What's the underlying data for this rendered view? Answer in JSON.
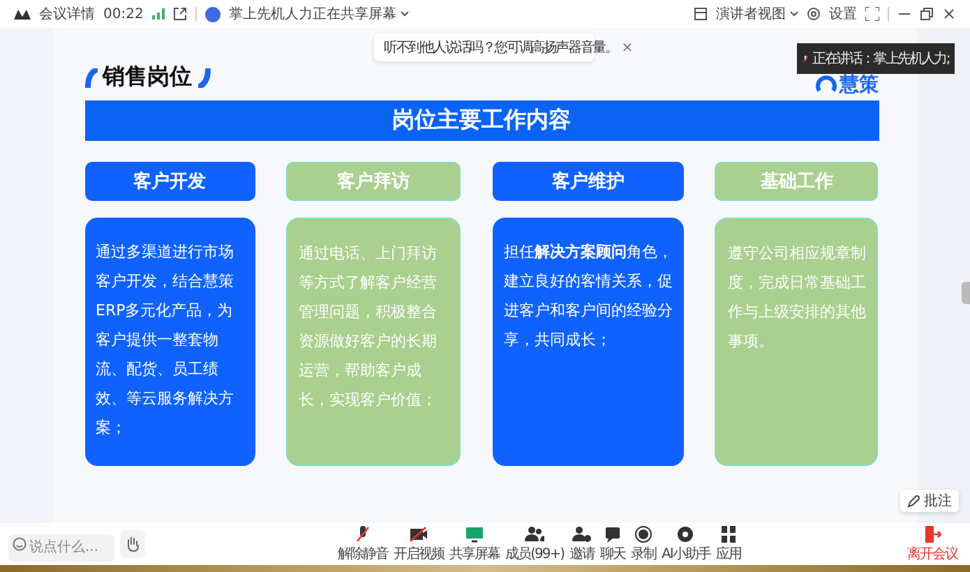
{
  "top_bar": {
    "app_label": "会议详情",
    "timer": "00:22",
    "share_status": "掌上先机人力正在共享屏幕",
    "view_menu": "演讲者视图",
    "settings": "设置"
  },
  "toast": {
    "message": "听不到他人说话吗？您可调高扬声器音量。",
    "close": "×"
  },
  "speaker_overlay": {
    "text": "正在讲话：掌上先机人力;"
  },
  "slide": {
    "heading": "销售岗位",
    "logo_text": "慧策",
    "banner": "岗位主要工作内容",
    "columns": [
      {
        "title": "客户开发",
        "color": "#0f62fe",
        "body": "通过多渠道进行市场客户开发，结合慧策ERP多元化产品，为客户提供一整套物流、配货、员工绩效、等云服务解决方案；"
      },
      {
        "title": "客户拜访",
        "color": "#a9d08e",
        "body": "通过电话、上门拜访等方式了解客户经营管理问题，积极整合资源做好客户的长期运营，帮助客户成长，实现客户价值；"
      },
      {
        "title": "客户维护",
        "color": "#0f62fe",
        "body": "担任**解决方案顾问**角色，建立良好的客情关系，促进客户和客户间的经验分享，共同成长；"
      },
      {
        "title": "基础工作",
        "color": "#a9d08e",
        "body": "遵守公司相应规章制度，完成日常基础工作与上级安排的其他事项。"
      }
    ]
  },
  "annotate_button": "批注",
  "bottom_bar": {
    "chat": {
      "placeholder": "说点什么..."
    },
    "tools": [
      {
        "label": "解除静音",
        "kind": "mic-off"
      },
      {
        "label": "开启视频",
        "kind": "camera-off"
      },
      {
        "label": "共享屏幕",
        "kind": "share"
      },
      {
        "label": "成员(99+)",
        "kind": "members"
      },
      {
        "label": "邀请",
        "kind": "invite"
      },
      {
        "label": "聊天",
        "kind": "chat"
      },
      {
        "label": "录制",
        "kind": "record"
      },
      {
        "label": "AI小助手",
        "kind": "ai"
      },
      {
        "label": "应用",
        "kind": "apps"
      }
    ],
    "leave": "离开会议"
  }
}
